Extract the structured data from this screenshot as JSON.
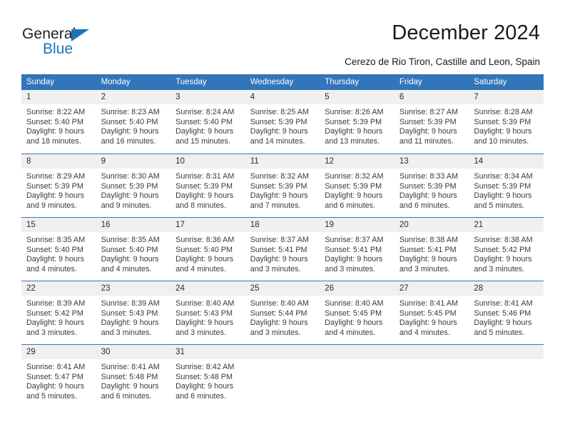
{
  "brand": {
    "name_top": "General",
    "name_bottom": "Blue",
    "accent_color": "#1b75bb"
  },
  "header": {
    "title": "December 2024",
    "subtitle": "Cerezo de Rio Tiron, Castille and Leon, Spain"
  },
  "theme": {
    "header_blue": "#3275b8",
    "day_band_gray": "#f0f0f0",
    "text_color": "#3a3a3a"
  },
  "weekday_headers": [
    "Sunday",
    "Monday",
    "Tuesday",
    "Wednesday",
    "Thursday",
    "Friday",
    "Saturday"
  ],
  "weeks": [
    [
      {
        "day": "1",
        "sunrise": "Sunrise: 8:22 AM",
        "sunset": "Sunset: 5:40 PM",
        "daylight1": "Daylight: 9 hours",
        "daylight2": "and 18 minutes."
      },
      {
        "day": "2",
        "sunrise": "Sunrise: 8:23 AM",
        "sunset": "Sunset: 5:40 PM",
        "daylight1": "Daylight: 9 hours",
        "daylight2": "and 16 minutes."
      },
      {
        "day": "3",
        "sunrise": "Sunrise: 8:24 AM",
        "sunset": "Sunset: 5:40 PM",
        "daylight1": "Daylight: 9 hours",
        "daylight2": "and 15 minutes."
      },
      {
        "day": "4",
        "sunrise": "Sunrise: 8:25 AM",
        "sunset": "Sunset: 5:39 PM",
        "daylight1": "Daylight: 9 hours",
        "daylight2": "and 14 minutes."
      },
      {
        "day": "5",
        "sunrise": "Sunrise: 8:26 AM",
        "sunset": "Sunset: 5:39 PM",
        "daylight1": "Daylight: 9 hours",
        "daylight2": "and 13 minutes."
      },
      {
        "day": "6",
        "sunrise": "Sunrise: 8:27 AM",
        "sunset": "Sunset: 5:39 PM",
        "daylight1": "Daylight: 9 hours",
        "daylight2": "and 11 minutes."
      },
      {
        "day": "7",
        "sunrise": "Sunrise: 8:28 AM",
        "sunset": "Sunset: 5:39 PM",
        "daylight1": "Daylight: 9 hours",
        "daylight2": "and 10 minutes."
      }
    ],
    [
      {
        "day": "8",
        "sunrise": "Sunrise: 8:29 AM",
        "sunset": "Sunset: 5:39 PM",
        "daylight1": "Daylight: 9 hours",
        "daylight2": "and 9 minutes."
      },
      {
        "day": "9",
        "sunrise": "Sunrise: 8:30 AM",
        "sunset": "Sunset: 5:39 PM",
        "daylight1": "Daylight: 9 hours",
        "daylight2": "and 9 minutes."
      },
      {
        "day": "10",
        "sunrise": "Sunrise: 8:31 AM",
        "sunset": "Sunset: 5:39 PM",
        "daylight1": "Daylight: 9 hours",
        "daylight2": "and 8 minutes."
      },
      {
        "day": "11",
        "sunrise": "Sunrise: 8:32 AM",
        "sunset": "Sunset: 5:39 PM",
        "daylight1": "Daylight: 9 hours",
        "daylight2": "and 7 minutes."
      },
      {
        "day": "12",
        "sunrise": "Sunrise: 8:32 AM",
        "sunset": "Sunset: 5:39 PM",
        "daylight1": "Daylight: 9 hours",
        "daylight2": "and 6 minutes."
      },
      {
        "day": "13",
        "sunrise": "Sunrise: 8:33 AM",
        "sunset": "Sunset: 5:39 PM",
        "daylight1": "Daylight: 9 hours",
        "daylight2": "and 6 minutes."
      },
      {
        "day": "14",
        "sunrise": "Sunrise: 8:34 AM",
        "sunset": "Sunset: 5:39 PM",
        "daylight1": "Daylight: 9 hours",
        "daylight2": "and 5 minutes."
      }
    ],
    [
      {
        "day": "15",
        "sunrise": "Sunrise: 8:35 AM",
        "sunset": "Sunset: 5:40 PM",
        "daylight1": "Daylight: 9 hours",
        "daylight2": "and 4 minutes."
      },
      {
        "day": "16",
        "sunrise": "Sunrise: 8:35 AM",
        "sunset": "Sunset: 5:40 PM",
        "daylight1": "Daylight: 9 hours",
        "daylight2": "and 4 minutes."
      },
      {
        "day": "17",
        "sunrise": "Sunrise: 8:36 AM",
        "sunset": "Sunset: 5:40 PM",
        "daylight1": "Daylight: 9 hours",
        "daylight2": "and 4 minutes."
      },
      {
        "day": "18",
        "sunrise": "Sunrise: 8:37 AM",
        "sunset": "Sunset: 5:41 PM",
        "daylight1": "Daylight: 9 hours",
        "daylight2": "and 3 minutes."
      },
      {
        "day": "19",
        "sunrise": "Sunrise: 8:37 AM",
        "sunset": "Sunset: 5:41 PM",
        "daylight1": "Daylight: 9 hours",
        "daylight2": "and 3 minutes."
      },
      {
        "day": "20",
        "sunrise": "Sunrise: 8:38 AM",
        "sunset": "Sunset: 5:41 PM",
        "daylight1": "Daylight: 9 hours",
        "daylight2": "and 3 minutes."
      },
      {
        "day": "21",
        "sunrise": "Sunrise: 8:38 AM",
        "sunset": "Sunset: 5:42 PM",
        "daylight1": "Daylight: 9 hours",
        "daylight2": "and 3 minutes."
      }
    ],
    [
      {
        "day": "22",
        "sunrise": "Sunrise: 8:39 AM",
        "sunset": "Sunset: 5:42 PM",
        "daylight1": "Daylight: 9 hours",
        "daylight2": "and 3 minutes."
      },
      {
        "day": "23",
        "sunrise": "Sunrise: 8:39 AM",
        "sunset": "Sunset: 5:43 PM",
        "daylight1": "Daylight: 9 hours",
        "daylight2": "and 3 minutes."
      },
      {
        "day": "24",
        "sunrise": "Sunrise: 8:40 AM",
        "sunset": "Sunset: 5:43 PM",
        "daylight1": "Daylight: 9 hours",
        "daylight2": "and 3 minutes."
      },
      {
        "day": "25",
        "sunrise": "Sunrise: 8:40 AM",
        "sunset": "Sunset: 5:44 PM",
        "daylight1": "Daylight: 9 hours",
        "daylight2": "and 3 minutes."
      },
      {
        "day": "26",
        "sunrise": "Sunrise: 8:40 AM",
        "sunset": "Sunset: 5:45 PM",
        "daylight1": "Daylight: 9 hours",
        "daylight2": "and 4 minutes."
      },
      {
        "day": "27",
        "sunrise": "Sunrise: 8:41 AM",
        "sunset": "Sunset: 5:45 PM",
        "daylight1": "Daylight: 9 hours",
        "daylight2": "and 4 minutes."
      },
      {
        "day": "28",
        "sunrise": "Sunrise: 8:41 AM",
        "sunset": "Sunset: 5:46 PM",
        "daylight1": "Daylight: 9 hours",
        "daylight2": "and 5 minutes."
      }
    ],
    [
      {
        "day": "29",
        "sunrise": "Sunrise: 8:41 AM",
        "sunset": "Sunset: 5:47 PM",
        "daylight1": "Daylight: 9 hours",
        "daylight2": "and 5 minutes."
      },
      {
        "day": "30",
        "sunrise": "Sunrise: 8:41 AM",
        "sunset": "Sunset: 5:48 PM",
        "daylight1": "Daylight: 9 hours",
        "daylight2": "and 6 minutes."
      },
      {
        "day": "31",
        "sunrise": "Sunrise: 8:42 AM",
        "sunset": "Sunset: 5:48 PM",
        "daylight1": "Daylight: 9 hours",
        "daylight2": "and 6 minutes."
      },
      {
        "day": "",
        "sunrise": "",
        "sunset": "",
        "daylight1": "",
        "daylight2": ""
      },
      {
        "day": "",
        "sunrise": "",
        "sunset": "",
        "daylight1": "",
        "daylight2": ""
      },
      {
        "day": "",
        "sunrise": "",
        "sunset": "",
        "daylight1": "",
        "daylight2": ""
      },
      {
        "day": "",
        "sunrise": "",
        "sunset": "",
        "daylight1": "",
        "daylight2": ""
      }
    ]
  ]
}
